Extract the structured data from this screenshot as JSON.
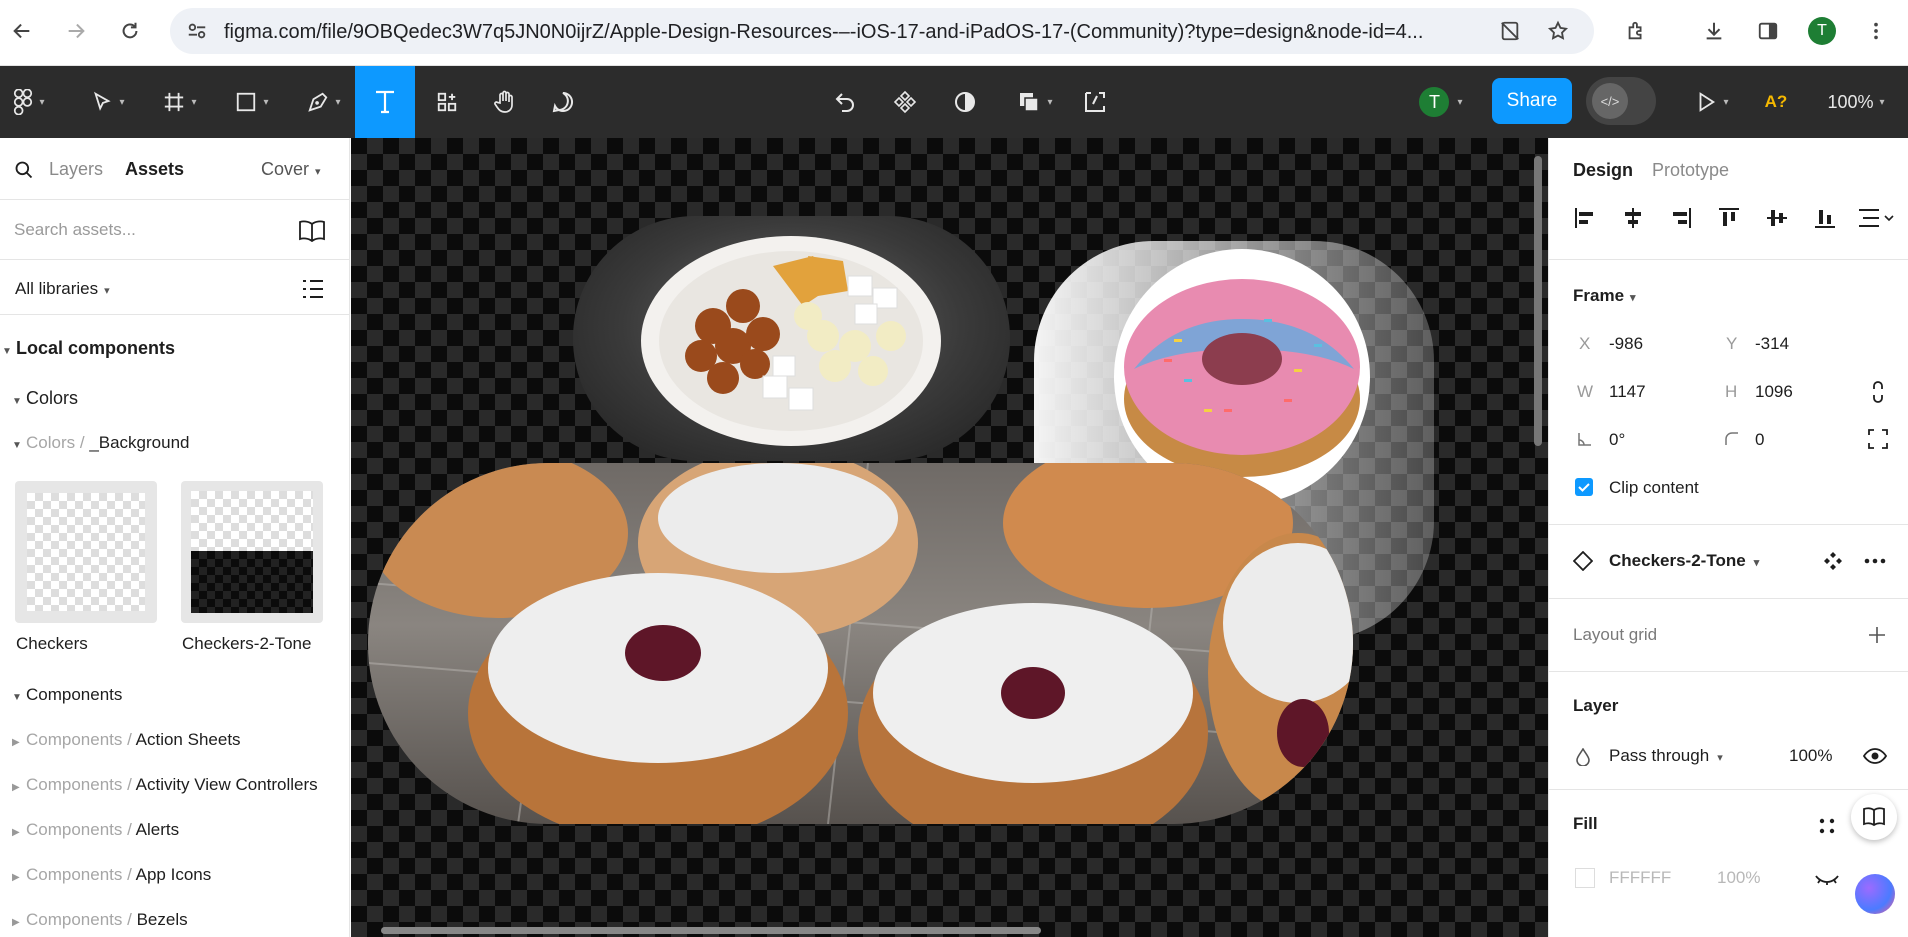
{
  "browser": {
    "url": "figma.com/file/9OBQedec3W7q5JN0N0ijrZ/Apple-Design-Resources-–-iOS-17-and-iPadOS-17-(Community)?type=design&node-id=4...",
    "profile_initial": "T"
  },
  "toolbar": {
    "user_initial": "T",
    "share_label": "Share",
    "font_warning": "A?",
    "zoom": "100%"
  },
  "left_panel": {
    "tabs": [
      "Layers",
      "Assets"
    ],
    "page_selector": "Cover",
    "search_placeholder": "Search assets...",
    "library_filter": "All libraries",
    "local_components": "Local components",
    "colors": "Colors",
    "colors_bg_prefix": "Colors /",
    "colors_bg_name": "_Background",
    "swatches": [
      "Checkers",
      "Checkers-2-Tone"
    ],
    "components": "Components",
    "component_groups": [
      {
        "prefix": "Components /",
        "name": "Action Sheets"
      },
      {
        "prefix": "Components /",
        "name": "Activity View Controllers"
      },
      {
        "prefix": "Components /",
        "name": "Alerts"
      },
      {
        "prefix": "Components /",
        "name": "App Icons"
      },
      {
        "prefix": "Components /",
        "name": "Bezels"
      }
    ]
  },
  "right_panel": {
    "tabs": [
      "Design",
      "Prototype"
    ],
    "frame_title": "Frame",
    "x_label": "X",
    "x": "-986",
    "y_label": "Y",
    "y": "-314",
    "w_label": "W",
    "w": "1147",
    "h_label": "H",
    "h": "1096",
    "rotation": "0°",
    "corner_radius": "0",
    "clip_content": "Clip content",
    "component_name": "Checkers-2-Tone",
    "layout_grid": "Layout grid",
    "layer_title": "Layer",
    "blend_mode": "Pass through",
    "opacity": "100%",
    "fill_title": "Fill",
    "fill_hex": "FFFFFF",
    "fill_opacity": "100%"
  },
  "colors": {
    "accent": "#0d99ff",
    "toolbar_bg": "#2c2c2c",
    "avatar_green": "#1e7e34"
  }
}
